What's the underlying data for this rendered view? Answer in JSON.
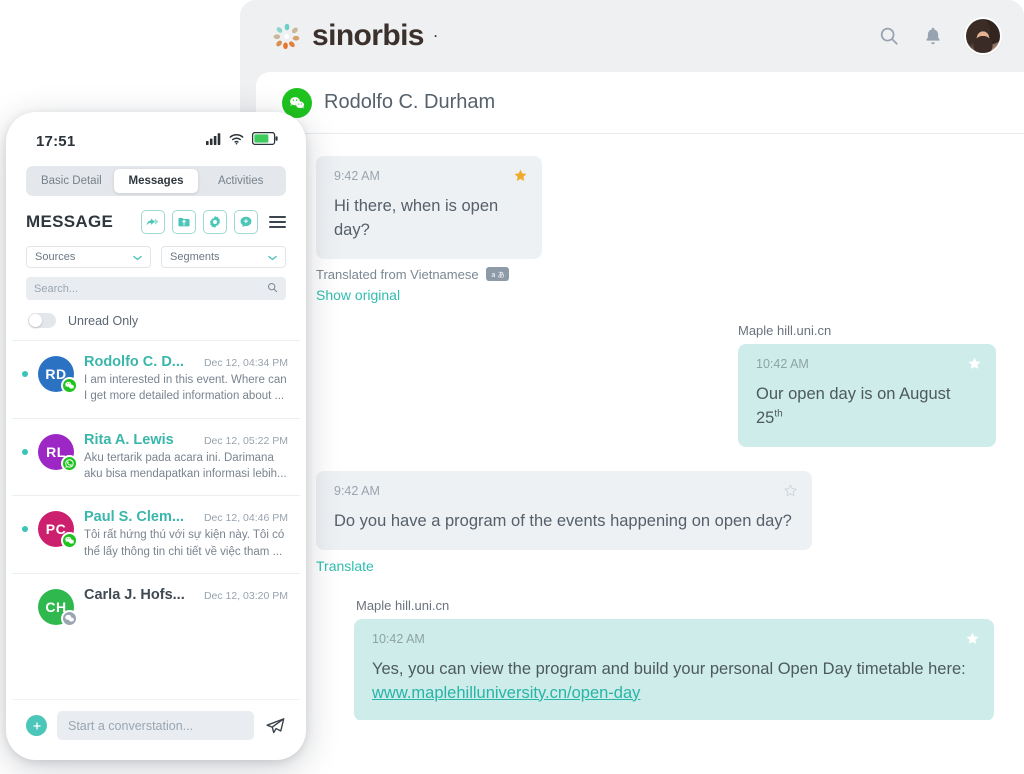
{
  "app": {
    "brand_name": "sinorbis",
    "brand_registered_mark": "·",
    "brand_color": "#3b302c",
    "accent_color": "#31bdb0",
    "header_icons": [
      "search-icon",
      "bell-icon",
      "user-avatar"
    ]
  },
  "conversation": {
    "contact_name": "Rodolfo C. Durham",
    "channel": "wechat",
    "messages": [
      {
        "direction": "in",
        "time": "9:42 AM",
        "text": "Hi there, when is open day?",
        "starred": true,
        "meta_text": "Translated from Vietnamese",
        "meta_badge": "あ",
        "action_label": "Show original"
      },
      {
        "direction": "out",
        "sender": "Maple hill.uni.cn",
        "time": "10:42 AM",
        "text": "Our open day is on August 25",
        "text_sup": "th",
        "starred": true
      },
      {
        "direction": "in",
        "time": "9:42 AM",
        "text": "Do you have a program of the events happening on open day?",
        "starred": false,
        "action_label": "Translate"
      },
      {
        "direction": "out",
        "sender": "Maple hill.uni.cn",
        "time": "10:42 AM",
        "text": "Yes, you can view the program and build your personal Open Day timetable here:",
        "link": "www.maplehilluniversity.cn/open-day",
        "starred": true
      }
    ]
  },
  "phone": {
    "status": {
      "time": "17:51",
      "signal": "signal-bars-icon",
      "wifi": "wifi-icon",
      "battery": "battery-icon",
      "battery_color": "#3dcb5c"
    },
    "tabs": [
      {
        "label": "Basic Detail",
        "active": false
      },
      {
        "label": "Messages",
        "active": true
      },
      {
        "label": "Activities",
        "active": false
      }
    ],
    "panel_title": "MESSAGE",
    "toolbar_buttons": [
      "reply-all-icon",
      "archive-icon",
      "settings-gear-icon",
      "new-message-icon"
    ],
    "menu_icon": "hamburger-menu-icon",
    "filters": [
      {
        "label": "Sources"
      },
      {
        "label": "Segments"
      }
    ],
    "search_placeholder": "Search...",
    "unread_toggle": {
      "label": "Unread Only",
      "on": false
    },
    "conversations": [
      {
        "initials": "RD",
        "avatar_color": "#2b73c2",
        "channel": "wechat",
        "name": "Rodolfo C. D...",
        "date": "Dec 12, 04:34 PM",
        "snippet": "I am interested in this event. Where can I get more detailed information about ...",
        "unread": true
      },
      {
        "initials": "RL",
        "avatar_color": "#9c27c4",
        "channel": "whatsapp",
        "name": "Rita A. Lewis",
        "date": "Dec 12, 05:22 PM",
        "snippet": "Aku tertarik pada acara ini. Darimana aku bisa mendapatkan informasi lebih...",
        "unread": true
      },
      {
        "initials": "PC",
        "avatar_color": "#cc1f6e",
        "channel": "wechat",
        "name": "Paul S. Clem...",
        "date": "Dec 12, 04:46 PM",
        "snippet": "Tôi rất hứng thú với sự kiện này. Tôi có thể lấy thông tin chi tiết về việc tham ...",
        "unread": true
      },
      {
        "initials": "CH",
        "avatar_color": "#2fb84e",
        "channel": "wechat",
        "name": "Carla J. Hofs...",
        "date": "Dec 12, 03:20 PM",
        "snippet": "",
        "unread": false
      }
    ],
    "composer": {
      "add_icon": "plus-icon",
      "placeholder": "Start a converstation...",
      "send_icon": "send-paper-plane-icon"
    }
  }
}
